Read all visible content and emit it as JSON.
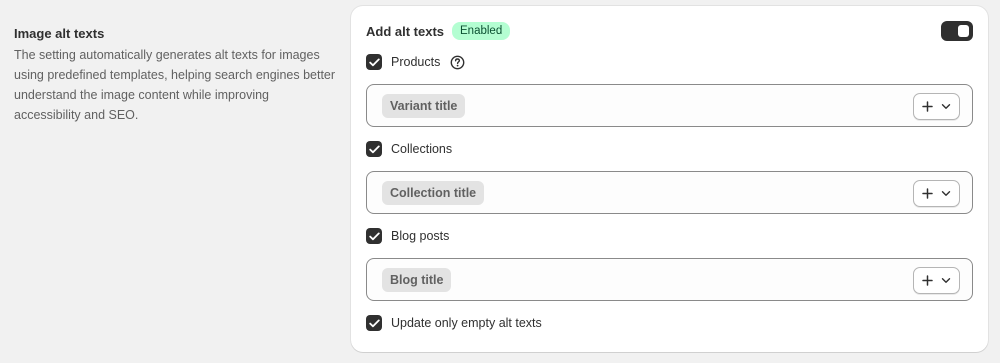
{
  "settings_section": {
    "title": "Image alt texts",
    "description": "The setting automatically generates alt texts for images using predefined templates, helping search engines better understand the image content while improving accessibility and SEO."
  },
  "card": {
    "title": "Add alt texts",
    "badge": "Enabled",
    "toggle_on": true
  },
  "options": {
    "products": {
      "label": "Products",
      "checked": true,
      "template": "Variant title"
    },
    "collections": {
      "label": "Collections",
      "checked": true,
      "template": "Collection title"
    },
    "blog_posts": {
      "label": "Blog posts",
      "checked": true,
      "template": "Blog title"
    },
    "update_empty": {
      "label": "Update only empty alt texts",
      "checked": true
    }
  },
  "icons": {
    "checkbox": "checkmark-icon",
    "help": "question-circle-icon",
    "add": "plus-icon",
    "dropdown": "chevron-down-icon"
  },
  "colors": {
    "background": "#f1f1f1",
    "card": "#ffffff",
    "badge_bg": "#b4fed2",
    "badge_text": "#0c5132",
    "toggle": "#303030"
  }
}
